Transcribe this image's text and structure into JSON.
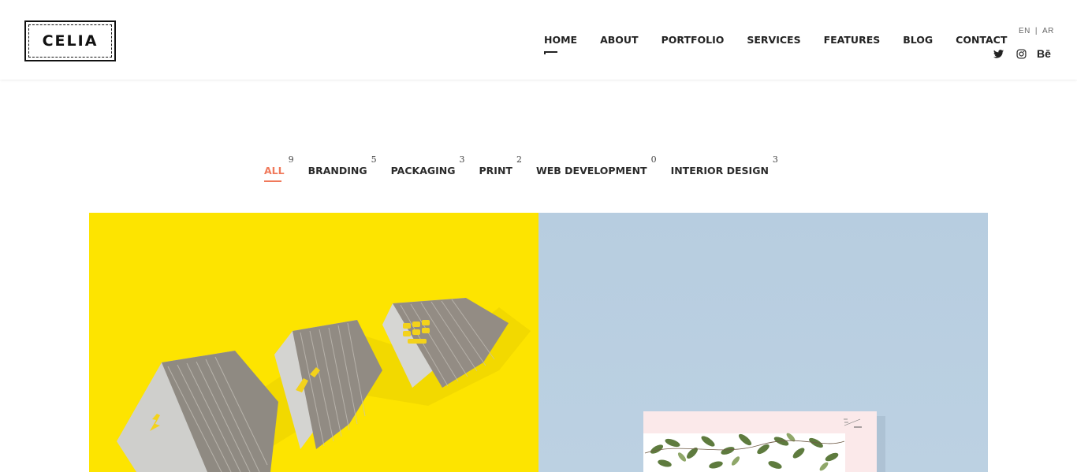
{
  "brand": {
    "logo_text": "CELIA"
  },
  "nav": {
    "items": [
      {
        "label": "HOME",
        "active": true
      },
      {
        "label": "ABOUT"
      },
      {
        "label": "PORTFOLIO"
      },
      {
        "label": "SERVICES"
      },
      {
        "label": "FEATURES"
      },
      {
        "label": "BLOG"
      },
      {
        "label": "CONTACT"
      }
    ]
  },
  "lang": {
    "en": "EN",
    "separator": "|",
    "ar": "AR"
  },
  "social": {
    "icons": [
      "twitter-icon",
      "instagram-icon",
      "behance-icon"
    ],
    "behance_label": "Bē"
  },
  "filters": [
    {
      "label": "ALL",
      "count": "9",
      "active": true
    },
    {
      "label": "BRANDING",
      "count": "5"
    },
    {
      "label": "PACKAGING",
      "count": "3"
    },
    {
      "label": "PRINT",
      "count": "2"
    },
    {
      "label": "WEB DEVELOPMENT",
      "count": "0"
    },
    {
      "label": "INTERIOR DESIGN",
      "count": "3"
    }
  ],
  "gallery": {
    "tiles": [
      {
        "image": "business-cards-on-yellow"
      },
      {
        "image": "floral-print-on-blue"
      }
    ]
  },
  "colors": {
    "accent": "#f0795b",
    "yellow": "#fde400",
    "blue": "#b9cfe0",
    "text": "#2a2a2a"
  }
}
